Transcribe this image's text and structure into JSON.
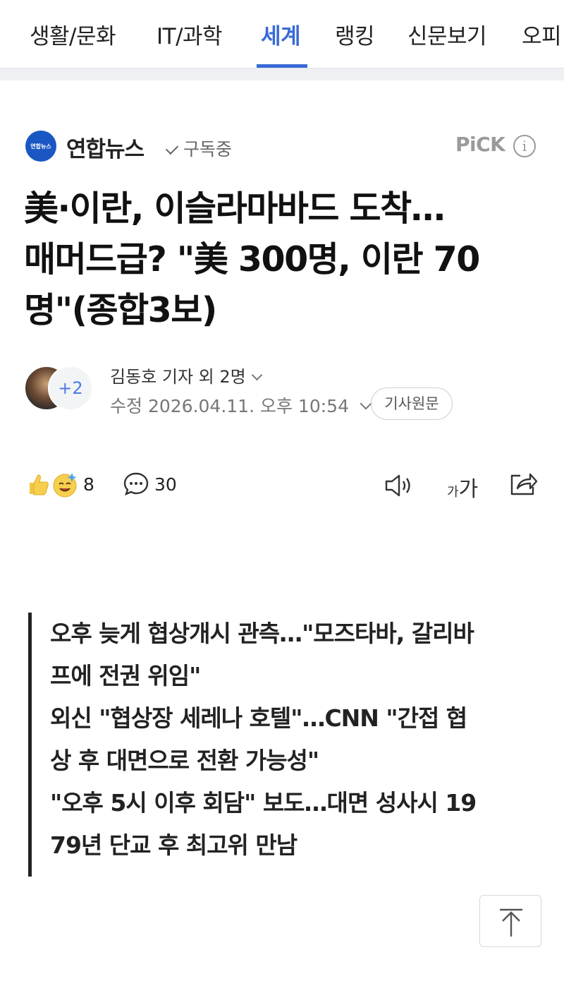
{
  "tabs": [
    "생활/문화",
    "IT/과학",
    "세계",
    "랭킹",
    "신문보기",
    "오피"
  ],
  "colors": {
    "accent": "#3a6ad6",
    "press_logo": "#1a57c2",
    "text": "#111111",
    "muted": "#777777"
  },
  "press": {
    "logo_text": "연합뉴스",
    "name": "연합뉴스",
    "subscribe_label": "구독중",
    "pick_label": "PiCK",
    "info_glyph": "i"
  },
  "headline": {
    "line1": "美·이란, 이슬라마바드 도착…",
    "line2": "매머드급? \"美 300명, 이란 70",
    "line3": "명\"(종합3보)"
  },
  "author": {
    "more_count": "+2",
    "byline": "김동호 기자 외 2명",
    "date": "수정 2026.04.11. 오후 10:54",
    "original_label": "기사원문"
  },
  "actions": {
    "reaction_count": "8",
    "comment_count": "30",
    "font_size_small": "가",
    "font_size_large": "가"
  },
  "summary": [
    "오후 늦게 협상개시 관측…\"모즈타바, 갈리바",
    "프에 전권 위임\"",
    "외신 \"협상장 세레나 호텔\"…CNN \"간접 협",
    "상 후 대면으로 전환 가능성\"",
    "\"오후 5시 이후 회담\" 보도…대면 성사시 19",
    "79년 단교 후 최고위 만남"
  ]
}
